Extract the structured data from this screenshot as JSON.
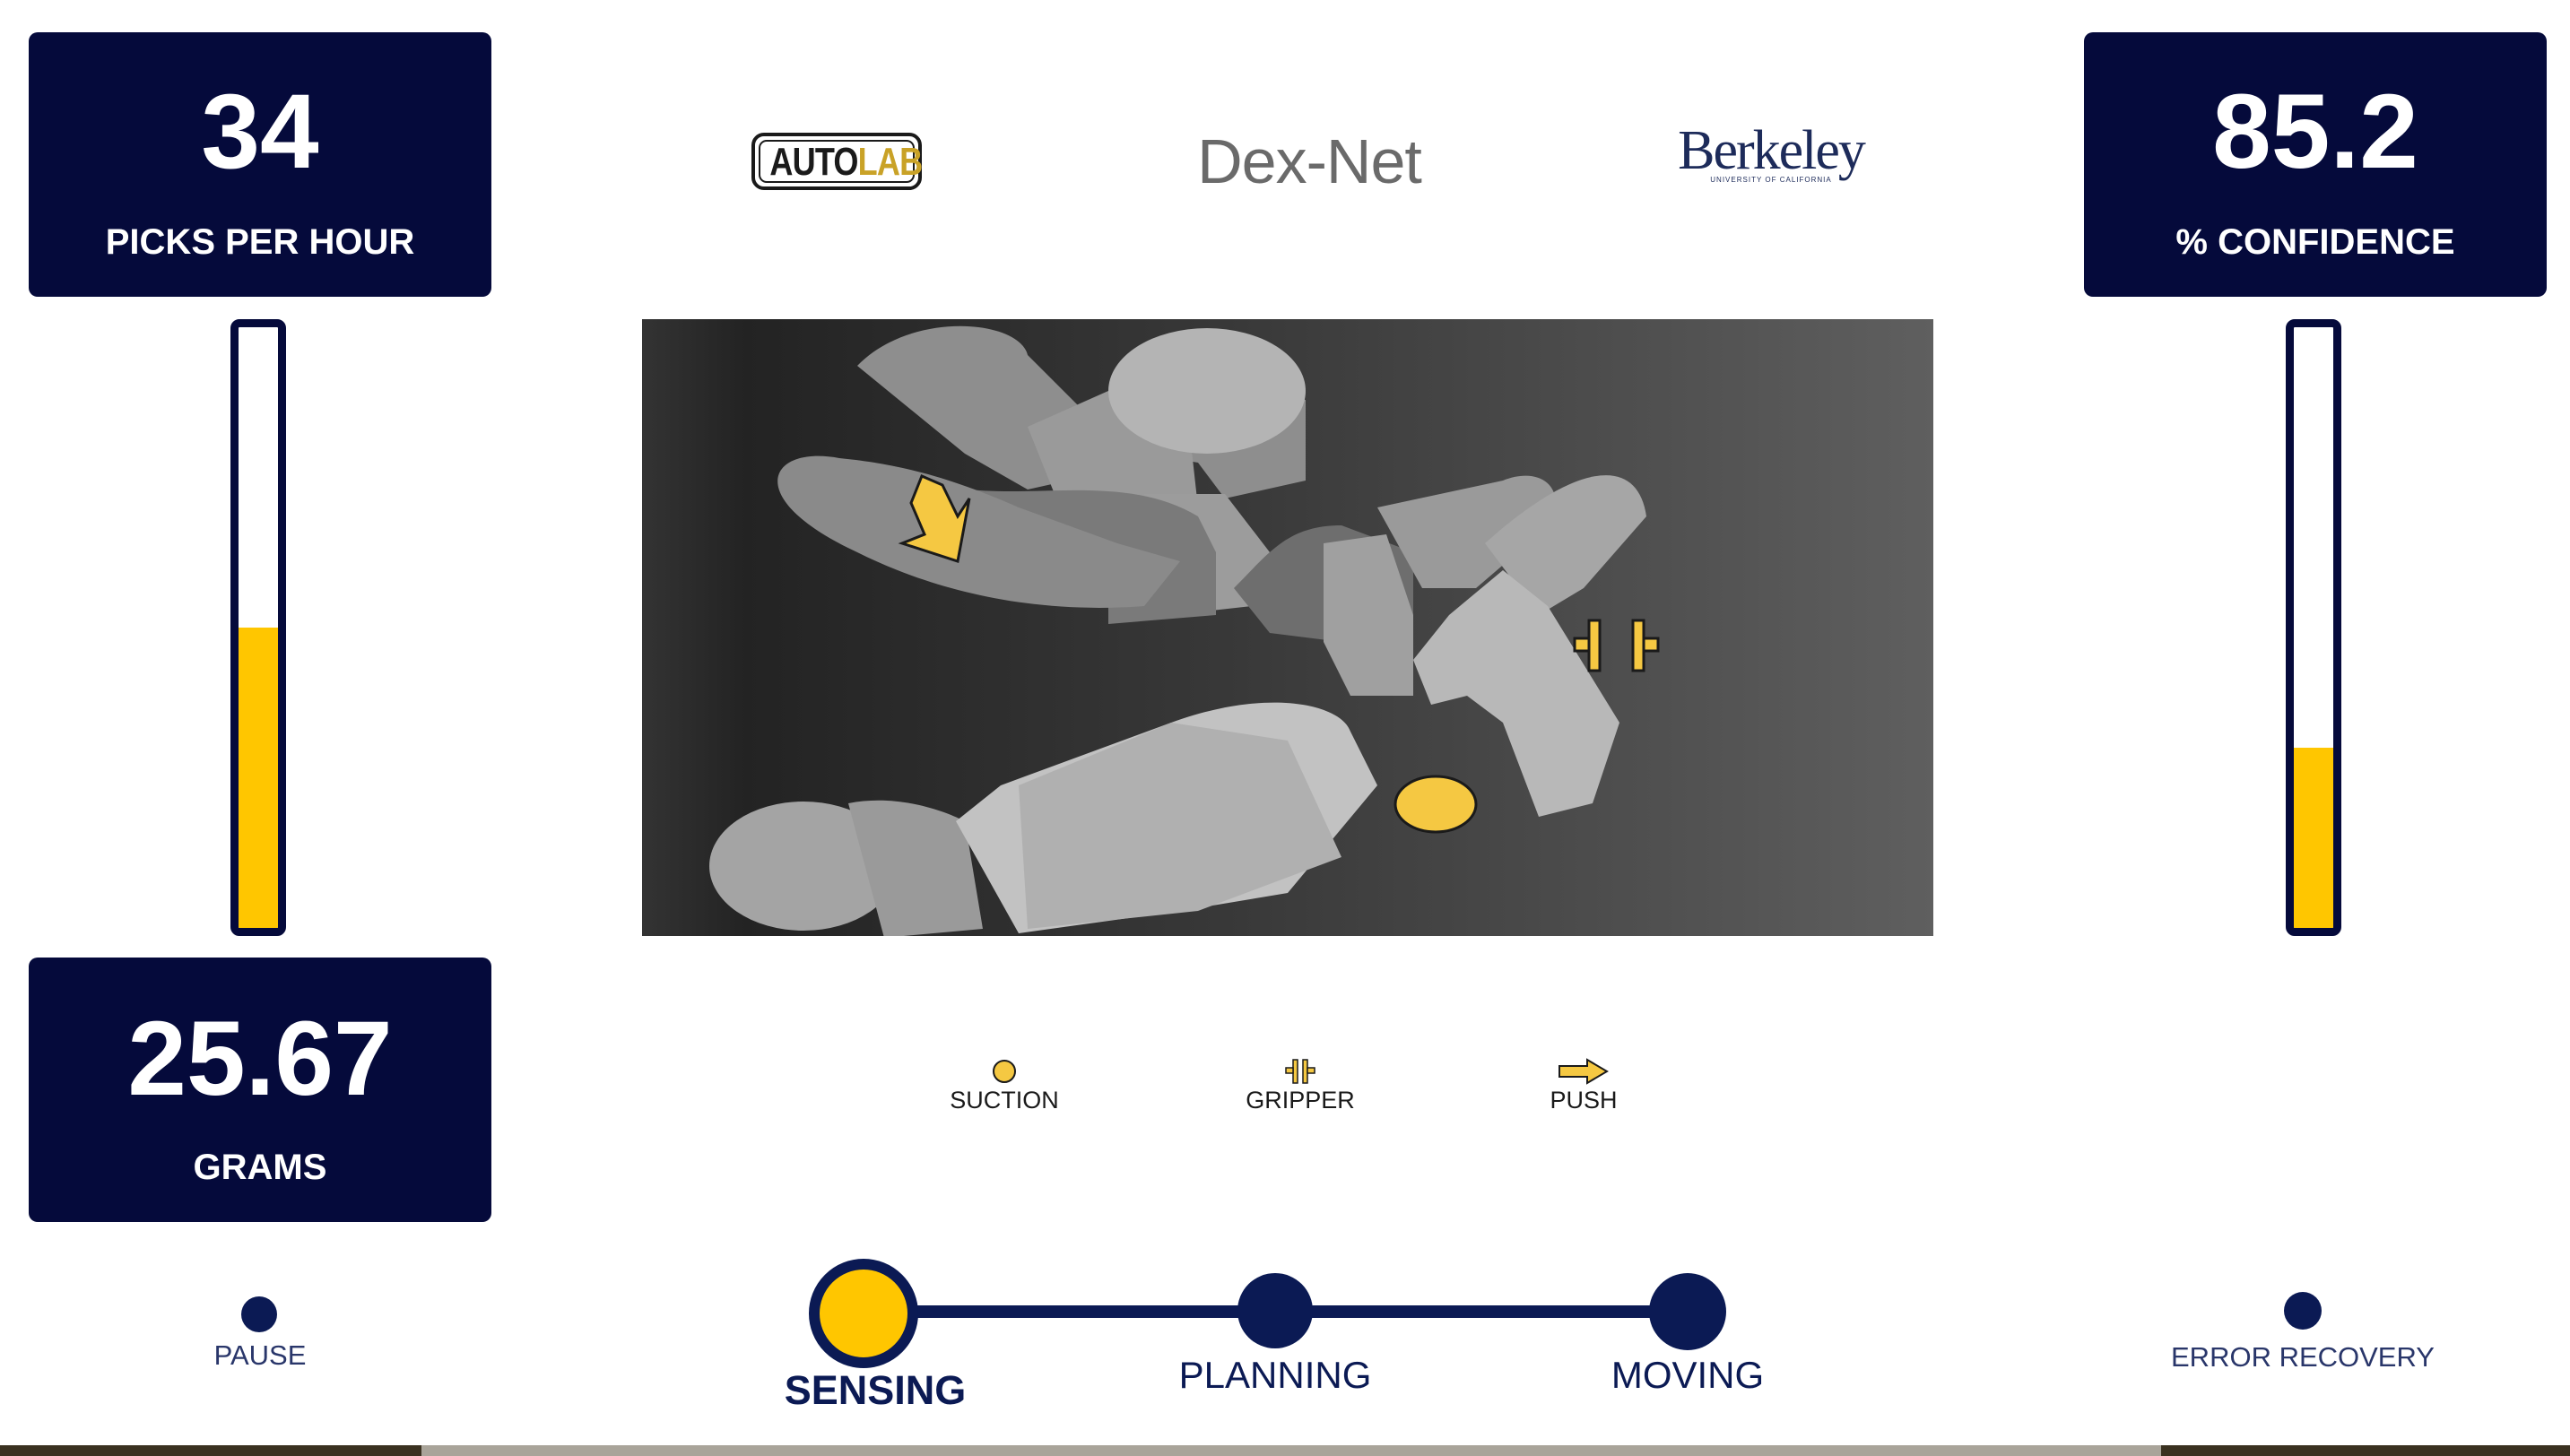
{
  "stats": {
    "picks": {
      "value": "34",
      "label": "PICKS PER HOUR"
    },
    "grams": {
      "value": "25.67",
      "label": "GRAMS"
    },
    "confidence": {
      "value": "85.2",
      "label": "% CONFIDENCE"
    }
  },
  "meters": {
    "picks_level": 0.5,
    "confidence_level": 0.3
  },
  "logos": {
    "autolab": {
      "auto": "AUTO",
      "lab": "LAB"
    },
    "dexnet": "Dex-Net",
    "berkeley": {
      "name": "Berkeley",
      "sub": "UNIVERSITY OF CALIFORNIA"
    }
  },
  "legend": {
    "suction": "SUCTION",
    "gripper": "GRIPPER",
    "push": "PUSH"
  },
  "controls": {
    "pause": "PAUSE",
    "error_recovery": "ERROR RECOVERY"
  },
  "stages": {
    "active": "sensing",
    "sensing": "SENSING",
    "planning": "PLANNING",
    "moving": "MOVING"
  },
  "colors": {
    "navy": "#050a3b",
    "accent_yellow": "#ffc600",
    "stage_navy": "#0b1a54"
  }
}
